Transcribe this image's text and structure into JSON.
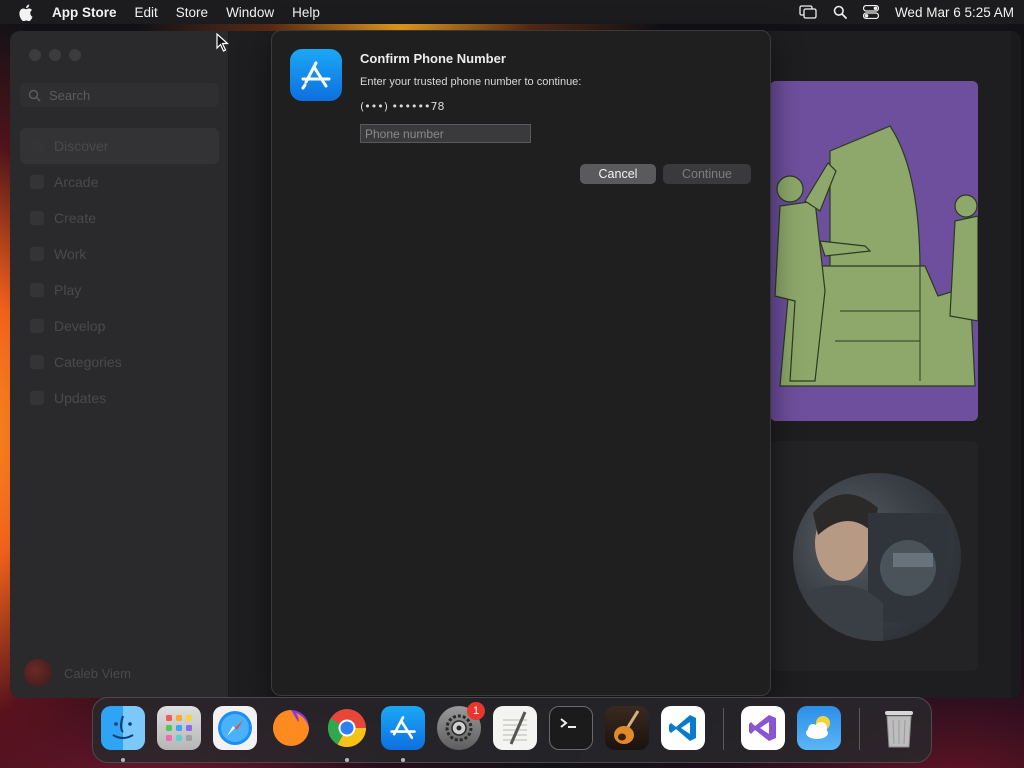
{
  "menubar": {
    "app_name": "App Store",
    "items": [
      "Edit",
      "Store",
      "Window",
      "Help"
    ],
    "datetime": "Wed Mar 6  5:25 AM"
  },
  "sidebar": {
    "search_placeholder": "Search",
    "items": [
      {
        "label": "Discover",
        "selected": true
      },
      {
        "label": "Arcade"
      },
      {
        "label": "Create"
      },
      {
        "label": "Work"
      },
      {
        "label": "Play"
      },
      {
        "label": "Develop"
      },
      {
        "label": "Categories"
      },
      {
        "label": "Updates"
      }
    ],
    "account_name": "Caleb Viem"
  },
  "dialog": {
    "title": "Confirm Phone Number",
    "subtitle": "Enter your trusted phone number to continue:",
    "masked_number": "(•••) ••••••78",
    "phone_placeholder": "Phone number",
    "phone_value": "",
    "cancel_label": "Cancel",
    "continue_label": "Continue",
    "continue_enabled": false
  },
  "dock": {
    "apps": [
      "Finder",
      "Launchpad",
      "Safari",
      "Firefox",
      "Chrome",
      "App Store",
      "System Settings",
      "TextEdit",
      "Terminal",
      "GarageBand",
      "Visual Studio Code",
      "Visual Studio",
      "Weather",
      "Trash"
    ],
    "system_settings_badge": "1"
  },
  "colors": {
    "accent_blue": "#0a84ff",
    "badge_red": "#e8362d",
    "illustration_purple": "#6e4f9e",
    "illustration_green": "#8da86a"
  }
}
